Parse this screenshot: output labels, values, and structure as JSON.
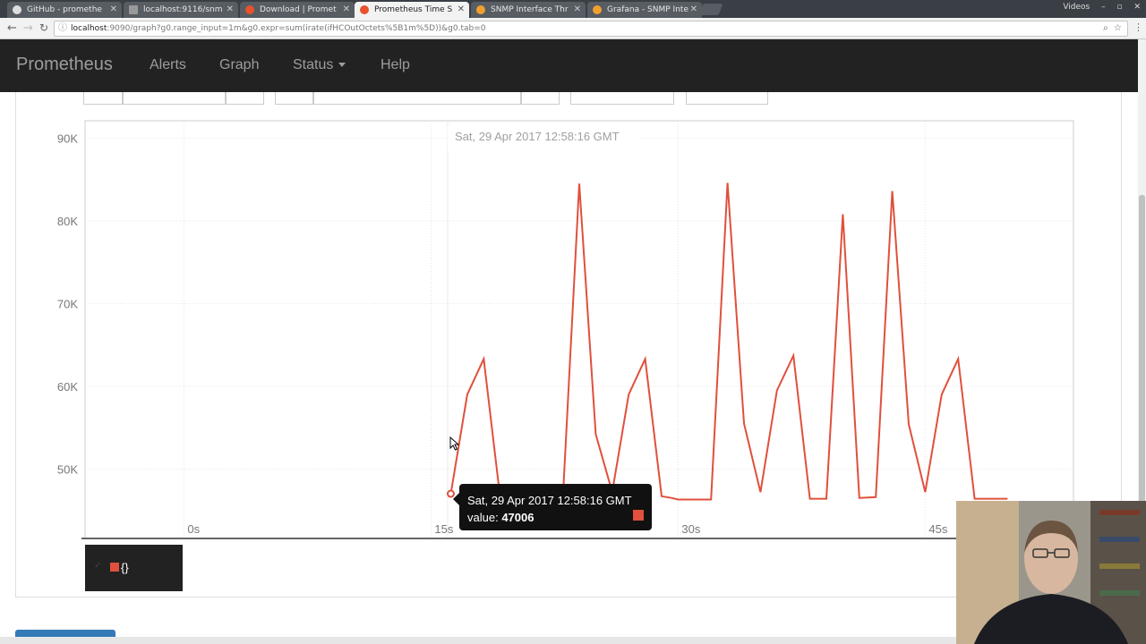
{
  "browser": {
    "tabs": [
      {
        "label": "GitHub - promethe",
        "active": false
      },
      {
        "label": "localhost:9116/snm",
        "active": false
      },
      {
        "label": "Download | Promet",
        "active": false
      },
      {
        "label": "Prometheus Time S",
        "active": true
      },
      {
        "label": "SNMP Interface Thr",
        "active": false
      },
      {
        "label": "Grafana - SNMP Inte",
        "active": false
      }
    ],
    "profile_label": "Videos",
    "url_host": "localhost",
    "url_rest": ":9090/graph?g0.range_input=1m&g0.expr=sum(irate(ifHCOutOctets%5B1m%5D))&g0.tab=0"
  },
  "navbar": {
    "brand": "Prometheus",
    "links": [
      "Alerts",
      "Graph",
      "Status",
      "Help"
    ]
  },
  "hover_time": "Sat, 29 Apr 2017 12:58:16 GMT",
  "tooltip": {
    "time": "Sat, 29 Apr 2017 12:58:16 GMT",
    "value_label": "value:",
    "value": "47006"
  },
  "legend": {
    "label": "{}",
    "color": "#e0503c"
  },
  "chart_data": {
    "type": "line",
    "y_ticks": [
      "90K",
      "80K",
      "70K",
      "60K",
      "50K"
    ],
    "y_tick_values": [
      90000,
      80000,
      70000,
      60000,
      50000
    ],
    "x_ticks": [
      "0s",
      "15s",
      "30s",
      "45s"
    ],
    "x_tick_values": [
      0,
      15,
      30,
      45
    ],
    "xlim": [
      -6,
      54
    ],
    "ylim": [
      41600,
      92100
    ],
    "series": [
      {
        "color": "#e0503c",
        "x": [
          16.2,
          17.2,
          18.2,
          19.2,
          20.0,
          23.0,
          24.0,
          25.0,
          26.0,
          27.0,
          28.0,
          29.0,
          29.6,
          30.0,
          31.0,
          32.0,
          33.0,
          34.0,
          35.0,
          36.0,
          37.0,
          38.0,
          39.0,
          40.0,
          41.0,
          42.0,
          43.0,
          44.0,
          45.0,
          46.0,
          47.0,
          48.0,
          49.0,
          50.0
        ],
        "y": [
          47006,
          59000,
          63300,
          46500,
          46500,
          46300,
          84500,
          54200,
          47200,
          59000,
          63300,
          46700,
          46500,
          46300,
          46300,
          46300,
          84600,
          55500,
          47200,
          59500,
          63700,
          46400,
          46400,
          80800,
          46500,
          46600,
          83600,
          55400,
          47200,
          59000,
          63300,
          46400,
          46400,
          46400
        ]
      }
    ]
  }
}
